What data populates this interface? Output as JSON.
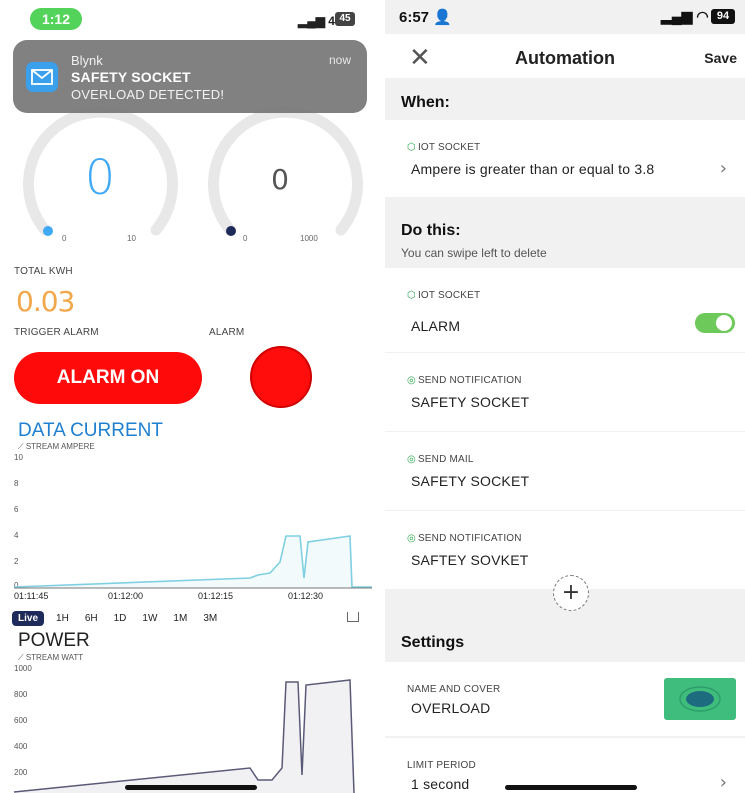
{
  "left": {
    "status": {
      "time": "1:12",
      "network": "4G",
      "battery": "45"
    },
    "notification": {
      "app": "Blynk",
      "title": "SAFETY SOCKET",
      "body": "OVERLOAD DETECTED!",
      "time": "now",
      "icon": "mail-icon"
    },
    "gauge1": {
      "value": "0",
      "min": "0",
      "max": "10",
      "color": "#3fa9f5"
    },
    "gauge2": {
      "value": "0",
      "min": "0",
      "max": "1000",
      "color": "#1e2a59"
    },
    "total_kwh_label": "TOTAL KWH",
    "total_kwh_value": "0.03",
    "trigger_alarm_label": "TRIGGER ALARM",
    "alarm_label": "ALARM",
    "alarm_button": "ALARM ON",
    "current_chart": {
      "title": "DATA CURRENT",
      "stream": "STREAM AMPERE",
      "y_ticks": [
        "10",
        "8",
        "6",
        "4",
        "2",
        "0"
      ],
      "x_ticks": [
        "01:11:45",
        "01:12:00",
        "01:12:15",
        "01:12:30"
      ]
    },
    "tabs": [
      "Live",
      "1H",
      "6H",
      "1D",
      "1W",
      "1M",
      "3M"
    ],
    "power_chart": {
      "title": "POWER",
      "stream": "STREAM WATT",
      "y_ticks": [
        "1000",
        "800",
        "600",
        "400",
        "200"
      ]
    }
  },
  "right": {
    "status": {
      "time": "6:57",
      "battery": "94"
    },
    "header": {
      "title": "Automation",
      "save": "Save"
    },
    "when": {
      "heading": "When:",
      "label": "IOT SOCKET",
      "value": "Ampere is greater than or equal to 3.8"
    },
    "do_this": {
      "heading": "Do this:",
      "subtitle": "You can swipe left to delete",
      "items": [
        {
          "label": "IOT SOCKET",
          "value": "ALARM"
        },
        {
          "label": "SEND NOTIFICATION",
          "value": "SAFETY SOCKET"
        },
        {
          "label": "SEND MAIL",
          "value": "SAFETY SOCKET"
        },
        {
          "label": "SEND NOTIFICATION",
          "value": "SAFTEY SOVKET"
        }
      ],
      "alarm_toggle_on": true
    },
    "settings": {
      "heading": "Settings",
      "name_label": "NAME AND COVER",
      "name_value": "OVERLOAD",
      "limit_label": "LIMIT PERIOD",
      "limit_value": "1 second"
    },
    "accent_green": "#6dc95a"
  }
}
